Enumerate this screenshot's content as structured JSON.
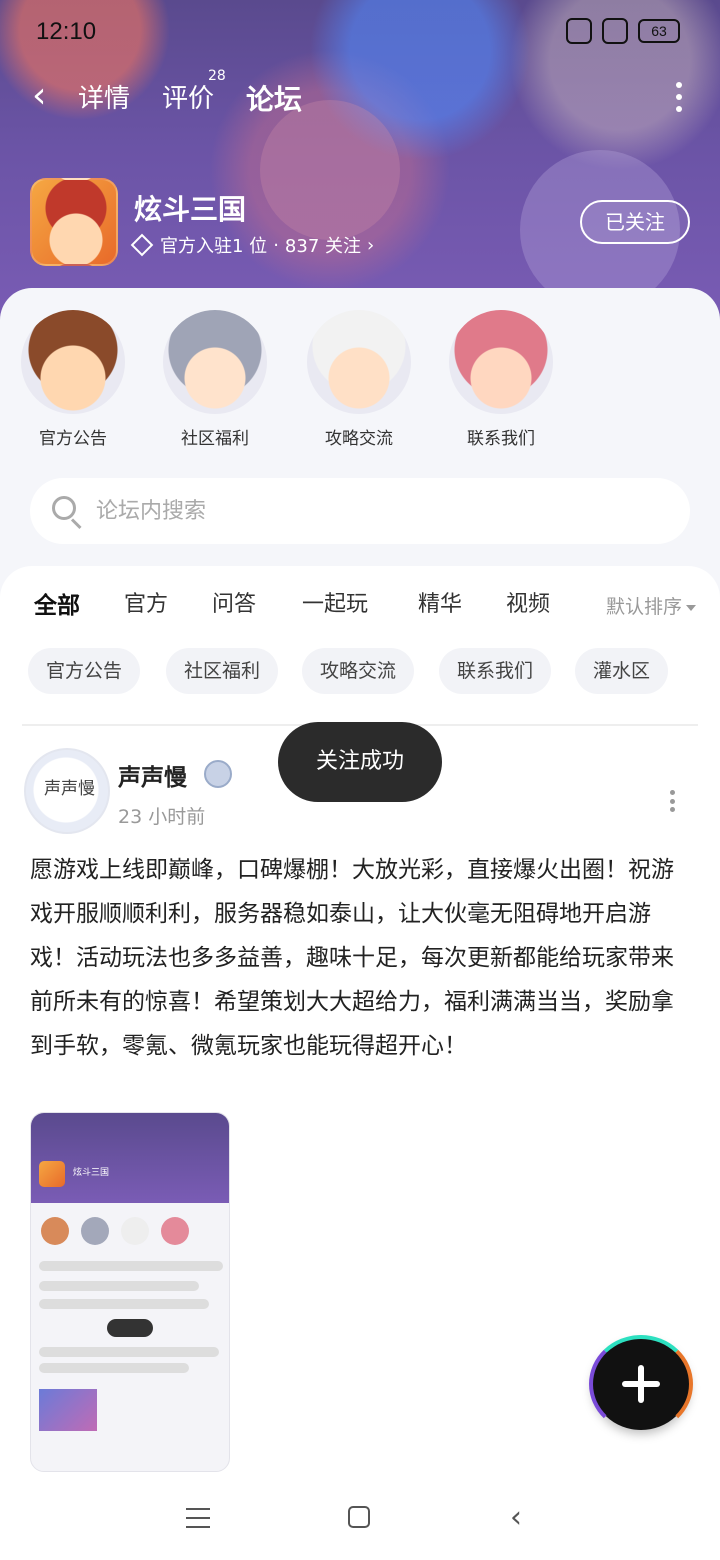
{
  "status_bar": {
    "time": "12:10",
    "battery": "63"
  },
  "nav": {
    "back_icon": "chevron-left-icon",
    "tabs": [
      {
        "label": "详情"
      },
      {
        "label": "评价",
        "badge": "28"
      },
      {
        "label": "论坛"
      }
    ],
    "active_tab": "论坛"
  },
  "game": {
    "name": "炫斗三国",
    "official_label": "官方入驻1 位",
    "separator": "·",
    "followers": "837 关注",
    "follow_button": "已关注"
  },
  "quick_links": [
    {
      "label": "官方公告"
    },
    {
      "label": "社区福利"
    },
    {
      "label": "攻略交流"
    },
    {
      "label": "联系我们"
    }
  ],
  "search": {
    "placeholder": "论坛内搜索"
  },
  "feed_tabs": [
    "全部",
    "官方",
    "问答",
    "一起玩",
    "精华",
    "视频"
  ],
  "active_feed_tab": "全部",
  "sort": "默认排序",
  "chips": [
    "官方公告",
    "社区福利",
    "攻略交流",
    "联系我们",
    "灌水区"
  ],
  "post": {
    "avatar_text": "声声慢",
    "author": "声声慢",
    "time": "23 小时前",
    "content": "愿游戏上线即巅峰，口碑爆棚！大放光彩，直接爆火出圈！祝游戏开服顺顺利利，服务器稳如泰山，让大伙毫无阻碍地开启游戏！活动玩法也多多益善，趣味十足，每次更新都能给玩家带来前所未有的惊喜！希望策划大大超给力，福利满满当当，奖励拿到手软，零氪、微氪玩家也能玩得超开心！"
  },
  "toast": "关注成功",
  "fab": {
    "icon": "plus-icon"
  },
  "colors": {
    "accent": "#2de0c0",
    "banner": "#6b54a6"
  }
}
